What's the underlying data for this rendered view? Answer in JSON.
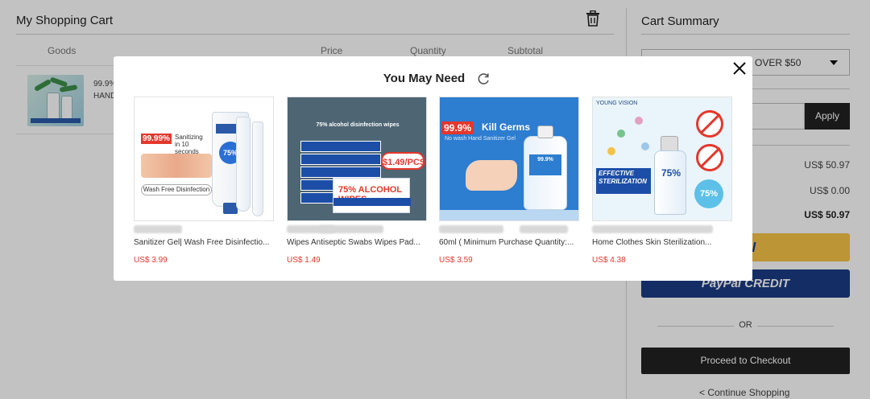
{
  "cart": {
    "title": "My Shopping Cart",
    "columns": {
      "goods": "Goods",
      "price": "Price",
      "quantity": "Quantity",
      "subtotal": "Subtotal"
    },
    "item": {
      "line1": "99.9%",
      "line2": "HAND"
    }
  },
  "summary": {
    "title": "Cart Summary",
    "coupon_select": "OVER $50",
    "apply_label": "Apply",
    "value1": "US$ 50.97",
    "value2": "US$ 0.00",
    "total": "US$ 50.97",
    "paypal_label": "Pal",
    "paypal_credit_label": "PayPal CREDIT",
    "or_label": "OR",
    "checkout_label": "Proceed to Checkout",
    "continue_label": "< Continue Shopping"
  },
  "modal": {
    "title": "You May Need",
    "products": [
      {
        "name": "Sanitizer Gel| Wash Free Disinfectio...",
        "price": "US$ 3.99",
        "img": {
          "badge": "99.99%",
          "badge_text": "Sanitizing in 10 seconds",
          "circle": "75%",
          "footer": "Wash Free Disinfection"
        }
      },
      {
        "name": "Wipes Antiseptic Swabs Wipes Pad...",
        "price": "US$ 1.49",
        "img": {
          "header": "75% alcohol disinfection wipes",
          "pack_text": "75% ALCOHOL WIPES",
          "price_tag": "$1.49/PCS"
        }
      },
      {
        "name": "60ml ( Minimum Purchase Quantity:...",
        "price": "US$ 3.59",
        "img": {
          "badge": "99.9%",
          "headline": "Kill Germs",
          "sub": "No wash Hand Sanitizer Gel",
          "label": "99.9%"
        }
      },
      {
        "name": "Home Clothes Skin Sterilization...",
        "price": "US$ 4.38",
        "img": {
          "brand": "YOUNG VISION",
          "effect": "EFFECTIVE STERILIZATION",
          "spray_pct": "75%",
          "circle_pct": "75%"
        }
      }
    ]
  },
  "colors": {
    "accent_red": "#e5372c",
    "paypal_yellow": "#f7c447",
    "paypal_blue": "#1b3c84",
    "dark_button": "#222222"
  },
  "icons": [
    "trash-icon",
    "refresh-icon",
    "close-icon",
    "chevron-down-icon"
  ]
}
